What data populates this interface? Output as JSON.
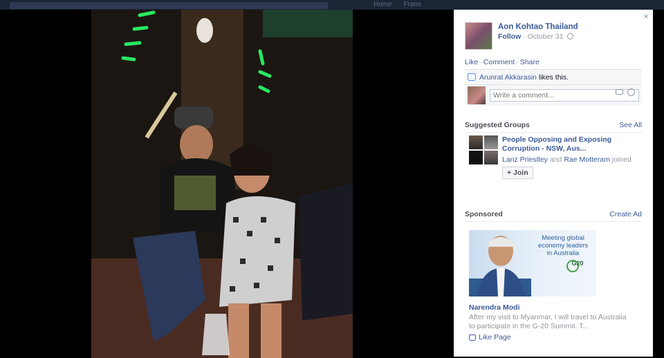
{
  "topbar": {
    "nav": [
      "Home",
      "Frans"
    ]
  },
  "post": {
    "author": "Aon Kohtao Thailand",
    "follow": "Follow",
    "date": "October 31",
    "actions": [
      "Like",
      "Comment",
      "Share"
    ],
    "liker": "Arunrat Akkarasin",
    "likes_suffix": "likes this.",
    "comment_placeholder": "Write a comment..."
  },
  "suggested": {
    "title": "Suggested Groups",
    "see_all": "See All",
    "group_name": "People Opposing and Exposing Corruption - NSW, Aus...",
    "member1": "Lanz Priestley",
    "and": "and",
    "member2": "Rae Motteram",
    "joined": "joined",
    "join_label": "+ Join"
  },
  "sponsored": {
    "title": "Sponsored",
    "create_ad": "Create Ad",
    "ad_headline": "Meeting global economy leaders in Australia",
    "ad_badge": "G20",
    "ad_title": "Narendra Modi",
    "ad_body": "After my visit to Myanmar, I will travel to Australia to participate in the G-20 Summit. T...",
    "like_page": "Like Page"
  },
  "close_glyph": "×"
}
